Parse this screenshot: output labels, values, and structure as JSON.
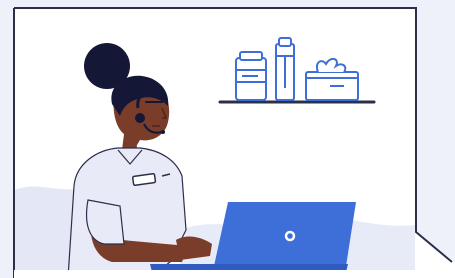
{
  "scene": {
    "subject": "telehealth-support-agent",
    "colors": {
      "background": "#eef0fa",
      "wall": "#ffffff",
      "outline": "#2b2f4a",
      "skin": "#7a3d2a",
      "hair": "#141735",
      "shirt": "#e9eaf7",
      "laptop": "#3e6fd8",
      "shelf_items": "#3e6fd8",
      "floor_pattern": "#dde1f3"
    },
    "icons": [
      "headset-icon",
      "medicine-bottle-icon",
      "pill-bottle-icon",
      "tissue-box-icon",
      "laptop-logo-icon"
    ]
  }
}
